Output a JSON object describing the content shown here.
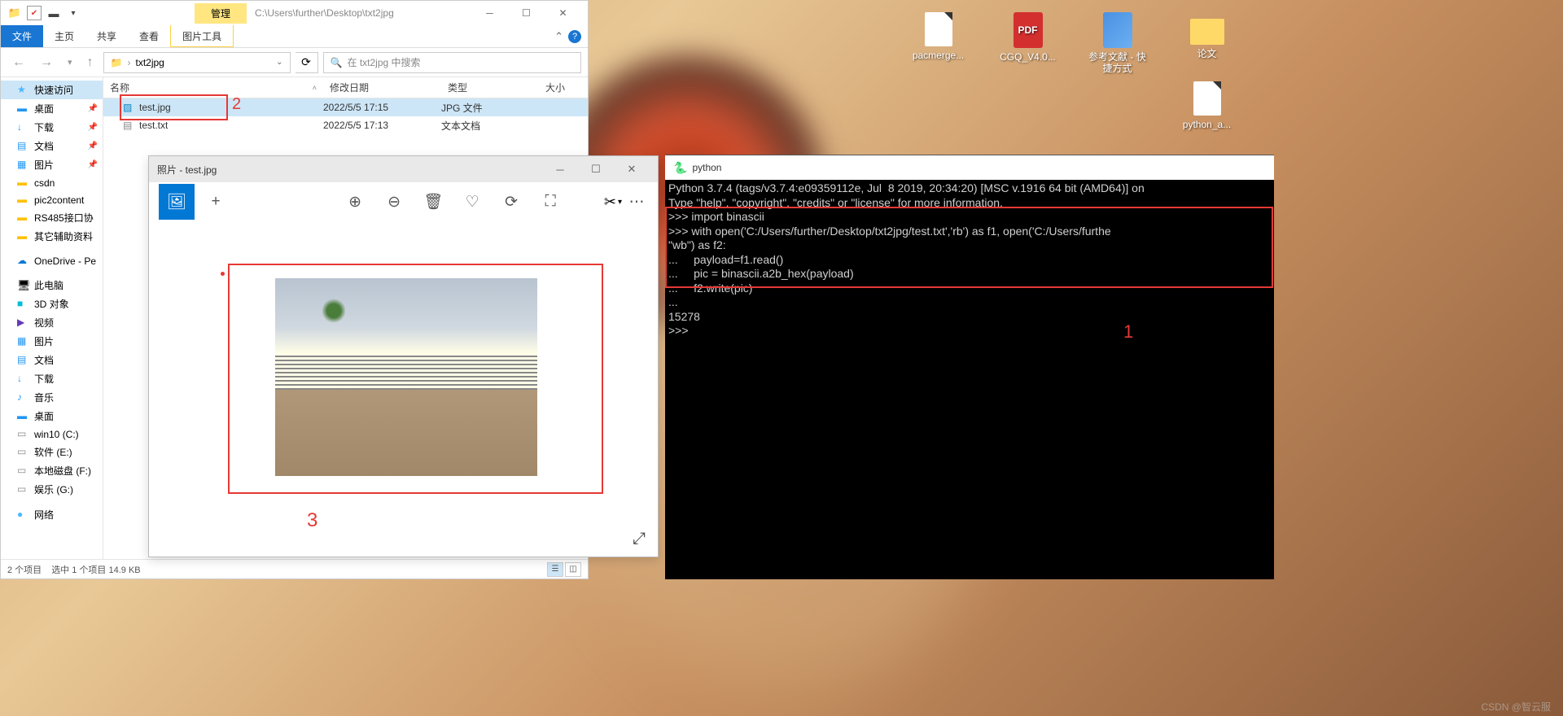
{
  "watermark": "CSDN @智云服",
  "desktop_icons": [
    {
      "name": "pacmerge...",
      "type": "file"
    },
    {
      "name": "CGQ_V4.0...",
      "type": "pdf",
      "label": "PDF"
    },
    {
      "name": "参考文献 - 快捷方式",
      "type": "doc"
    },
    {
      "name": "论文",
      "type": "folder"
    },
    {
      "name": "python_a...",
      "type": "file"
    }
  ],
  "explorer": {
    "manage": "管理",
    "title_path": "C:\\Users\\further\\Desktop\\txt2jpg",
    "ribbon": {
      "file": "文件",
      "home": "主页",
      "share": "共享",
      "view": "查看",
      "pic_tools": "图片工具"
    },
    "address": {
      "folder": "txt2jpg"
    },
    "search_placeholder": "在 txt2jpg 中搜索",
    "sidebar": [
      {
        "label": "快速访问",
        "icon": "ic-star",
        "sel": true
      },
      {
        "label": "桌面",
        "icon": "ic-desk",
        "pin": true
      },
      {
        "label": "下载",
        "icon": "ic-down",
        "pin": true
      },
      {
        "label": "文档",
        "icon": "ic-doc",
        "pin": true
      },
      {
        "label": "图片",
        "icon": "ic-pic",
        "pin": true
      },
      {
        "label": "csdn",
        "icon": "ic-fold"
      },
      {
        "label": "pic2content",
        "icon": "ic-fold"
      },
      {
        "label": "RS485接口协",
        "icon": "ic-fold"
      },
      {
        "label": "其它辅助资料",
        "icon": "ic-fold"
      },
      {
        "sep": true
      },
      {
        "label": "OneDrive - Pe",
        "icon": "ic-od"
      },
      {
        "sep": true
      },
      {
        "label": "此电脑",
        "icon": "ic-pc"
      },
      {
        "label": "3D 对象",
        "icon": "ic-3d"
      },
      {
        "label": "视频",
        "icon": "ic-vid"
      },
      {
        "label": "图片",
        "icon": "ic-pic"
      },
      {
        "label": "文档",
        "icon": "ic-doc"
      },
      {
        "label": "下载",
        "icon": "ic-down"
      },
      {
        "label": "音乐",
        "icon": "ic-mus"
      },
      {
        "label": "桌面",
        "icon": "ic-desk"
      },
      {
        "label": "win10 (C:)",
        "icon": "ic-drv"
      },
      {
        "label": "软件 (E:)",
        "icon": "ic-drv"
      },
      {
        "label": "本地磁盘 (F:)",
        "icon": "ic-drv"
      },
      {
        "label": "娱乐 (G:)",
        "icon": "ic-drv"
      },
      {
        "sep": true
      },
      {
        "label": "网络",
        "icon": "ic-net"
      }
    ],
    "columns": {
      "name": "名称",
      "date": "修改日期",
      "type": "类型",
      "size": "大小"
    },
    "rows": [
      {
        "name": "test.jpg",
        "date": "2022/5/5 17:15",
        "type": "JPG 文件",
        "ico": "jpg",
        "sel": true
      },
      {
        "name": "test.txt",
        "date": "2022/5/5 17:13",
        "type": "文本文档",
        "ico": "txt",
        "sel": false
      }
    ],
    "status": {
      "items": "2 个项目",
      "selected": "选中 1 个项目 14.9 KB"
    }
  },
  "photos": {
    "title": "照片 - test.jpg"
  },
  "terminal": {
    "title": "python",
    "lines": [
      "Python 3.7.4 (tags/v3.7.4:e09359112e, Jul  8 2019, 20:34:20) [MSC v.1916 64 bit (AMD64)] on",
      "Type \"help\", \"copyright\", \"credits\" or \"license\" for more information.",
      ">>> import binascii",
      ">>> with open('C:/Users/further/Desktop/txt2jpg/test.txt','rb') as f1, open('C:/Users/furthe",
      "\"wb\") as f2:",
      "...     payload=f1.read()",
      "...     pic = binascii.a2b_hex(payload)",
      "...     f2.write(pic)",
      "...",
      "15278",
      ">>>"
    ]
  },
  "annotations": {
    "one": "1",
    "two": "2",
    "three": "3"
  }
}
